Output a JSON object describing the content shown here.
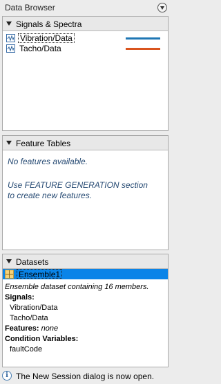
{
  "window": {
    "title": "Data Browser"
  },
  "signals_panel": {
    "title": "Signals & Spectra",
    "items": [
      {
        "label": "Vibration/Data",
        "color": "#1f77b4"
      },
      {
        "label": "Tacho/Data",
        "color": "#d9541e"
      }
    ]
  },
  "features_panel": {
    "title": "Feature Tables",
    "empty_line1": "No features available.",
    "hint_line1": "Use FEATURE GENERATION section",
    "hint_line2": "to create new features."
  },
  "datasets_panel": {
    "title": "Datasets",
    "selected": "Ensemble1",
    "description": "Ensemble dataset containing 16 members.",
    "signals_label": "Signals:",
    "signals": [
      "Vibration/Data",
      "Tacho/Data"
    ],
    "features_label": "Features:",
    "features_value": "none",
    "condition_label": "Condition Variables:",
    "conditions": [
      "faultCode"
    ]
  },
  "status": {
    "message": "The New Session dialog is now open."
  }
}
